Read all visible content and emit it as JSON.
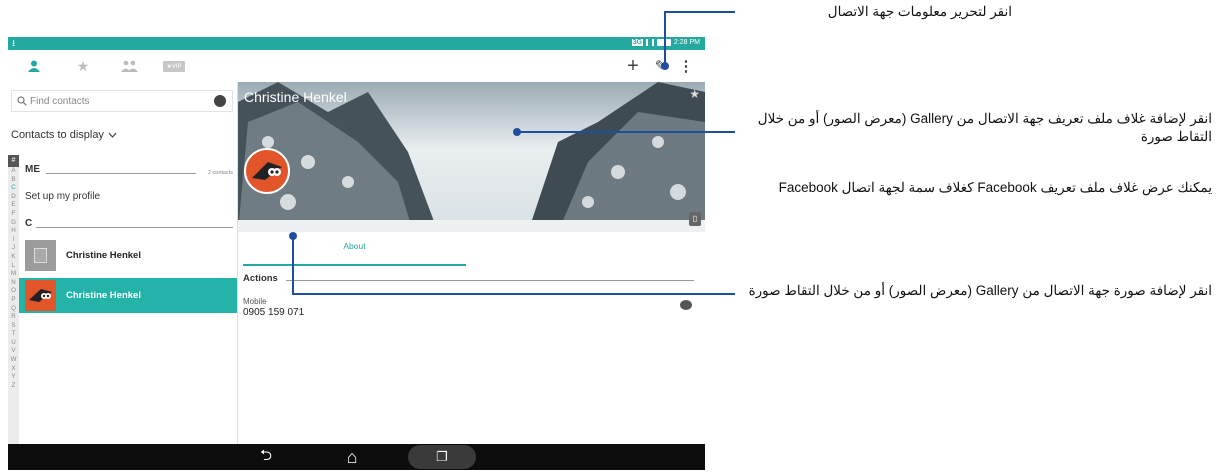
{
  "statusbar": {
    "download_glyph": "⭳",
    "network": "3G",
    "time": "2:28 PM"
  },
  "toolbar": {
    "tabs": [
      {
        "icon": "person-icon",
        "active": true
      },
      {
        "icon": "star-icon",
        "active": false
      },
      {
        "icon": "group-icon",
        "active": false
      },
      {
        "icon": "vip-icon",
        "label": "★VIP",
        "active": false
      }
    ],
    "add_label": "+",
    "edit_label": "✎",
    "menu_label": "⋮"
  },
  "left_pane": {
    "search_placeholder": "Find contacts",
    "contacts_to_display": "Contacts to display",
    "index_hash": "#",
    "index_letters": [
      "A",
      "B",
      "C",
      "D",
      "E",
      "F",
      "G",
      "H",
      "I",
      "J",
      "K",
      "L",
      "M",
      "N",
      "O",
      "P",
      "Q",
      "R",
      "S",
      "T",
      "U",
      "V",
      "W",
      "X",
      "Y",
      "Z"
    ],
    "active_letter": "C",
    "me_section": "ME",
    "me_count": "2 contacts",
    "setup_profile": "Set up my profile",
    "c_section": "C",
    "contacts": [
      {
        "name": "Christine Henkel",
        "avatar": "generic",
        "selected": false
      },
      {
        "name": "Christine Henkel",
        "avatar": "photo",
        "selected": true
      }
    ]
  },
  "detail": {
    "name": "Christine Henkel",
    "tab_about": "About",
    "actions_label": "Actions",
    "mobile_label": "Mobile",
    "mobile_number": "0905 159 071"
  },
  "navbar": {
    "back": "⮌",
    "home": "⌂",
    "recents": "❐"
  },
  "callouts": {
    "edit": "انقر لتحرير معلومات جهة الاتصال",
    "cover": "انقر لإضافة غلاف ملف تعريف جهة الاتصال من Gallery (معرض الصور) أو من خلال التقاط صورة",
    "facebook": "يمكنك عرض غلاف ملف تعريف Facebook كغلاف سمة لجهة اتصال Facebook",
    "photo": "انقر لإضافة صورة جهة الاتصال من Gallery (معرض الصور) أو من خلال التقاط صورة"
  },
  "colors": {
    "accent": "#23a9a0",
    "callout_line": "#1f4e9e",
    "avatar_orange": "#e2552b"
  }
}
